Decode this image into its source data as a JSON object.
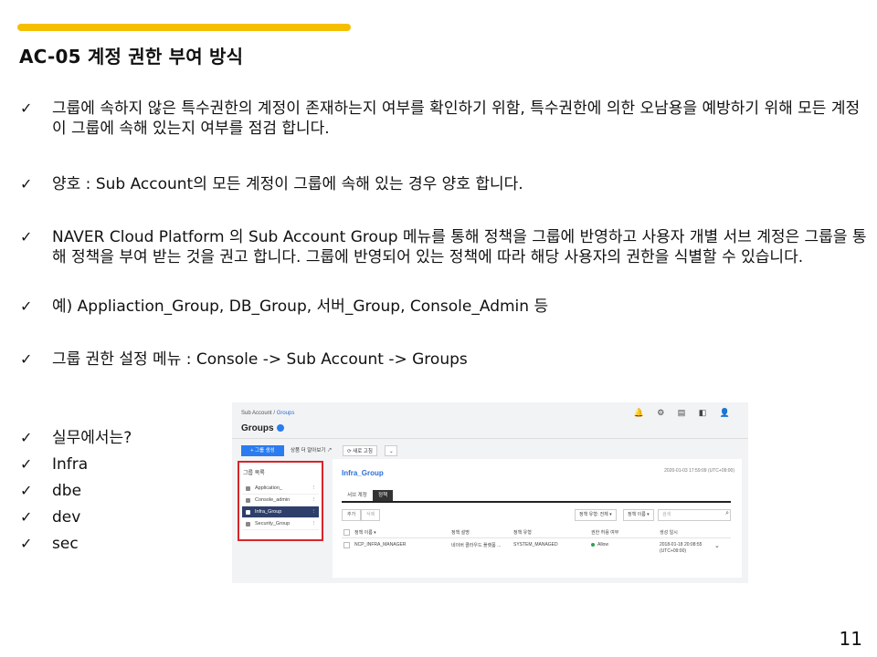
{
  "title": "AC-05 계정 권한 부여 방식",
  "accent_color": "#f5bf00",
  "check_glyph": "✓",
  "bullets": [
    "그룹에 속하지 않은 특수권한의 계정이 존재하는지 여부를 확인하기 위함, 특수권한에 의한 오남용을 예방하기 위해 모든 계정이 그룹에 속해 있는지 여부를 점검 합니다.",
    "양호 : Sub Account의 모든 계정이 그룹에 속해 있는 경우 양호 합니다.",
    "NAVER Cloud Platform 의 Sub Account Group 메뉴를 통해 정책을 그룹에 반영하고 사용자 개별 서브 계정은 그룹을 통해 정책을 부여 받는 것을 권고 합니다. 그룹에 반영되어 있는 정책에 따라 해당 사용자의 권한을 식별할 수 있습니다.",
    "예) Appliaction_Group, DB_Group, 서버_Group, Console_Admin 등",
    "그룹 권한 설정 메뉴 : Console -> Sub Account -> Groups",
    "실무에서는?",
    "Infra",
    "dbe",
    "dev",
    "sec"
  ],
  "page_number": "11",
  "screenshot": {
    "breadcrumb_root": "Sub Account",
    "breadcrumb_sep": " / ",
    "breadcrumb_current": "Groups",
    "top_icons": "🔔 ⚙ ▤ ◧ 👤",
    "heading": "Groups",
    "create_button": "+ 그룹 생성",
    "toolbar": [
      "상품 더 알아보기 ↗",
      "⟳ 새로 고침",
      "⌄"
    ],
    "left_panel_title": "그룹 목록",
    "groups": [
      "Application_",
      "Console_admin",
      "Infra_Group",
      "Security_Group"
    ],
    "selected_group_index": 2,
    "detail_title": "Infra_Group",
    "detail_date": "2020-01-03 17:59:09 (UTC+09:00)",
    "tabs": [
      "서브 계정",
      "정책"
    ],
    "active_tab_index": 1,
    "filter_buttons": [
      "추가",
      "삭제"
    ],
    "filter_selects": [
      "정책 유형: 전체 ▾",
      "정책 이름 ▾"
    ],
    "search_placeholder": "검색",
    "columns": [
      "정책 이름 ▾",
      "정책 설명",
      "정책 유형",
      "권한 허용 여부",
      "생성 일시"
    ],
    "rows": [
      {
        "name": "NCP_INFRA_MANAGER",
        "description": "네이버 클라우드 플랫폼 ...",
        "type": "SYSTEM_MANAGED",
        "allow": "Allow",
        "created": "2018-01-18 20:08:55 (UTC+09:00)"
      }
    ]
  }
}
